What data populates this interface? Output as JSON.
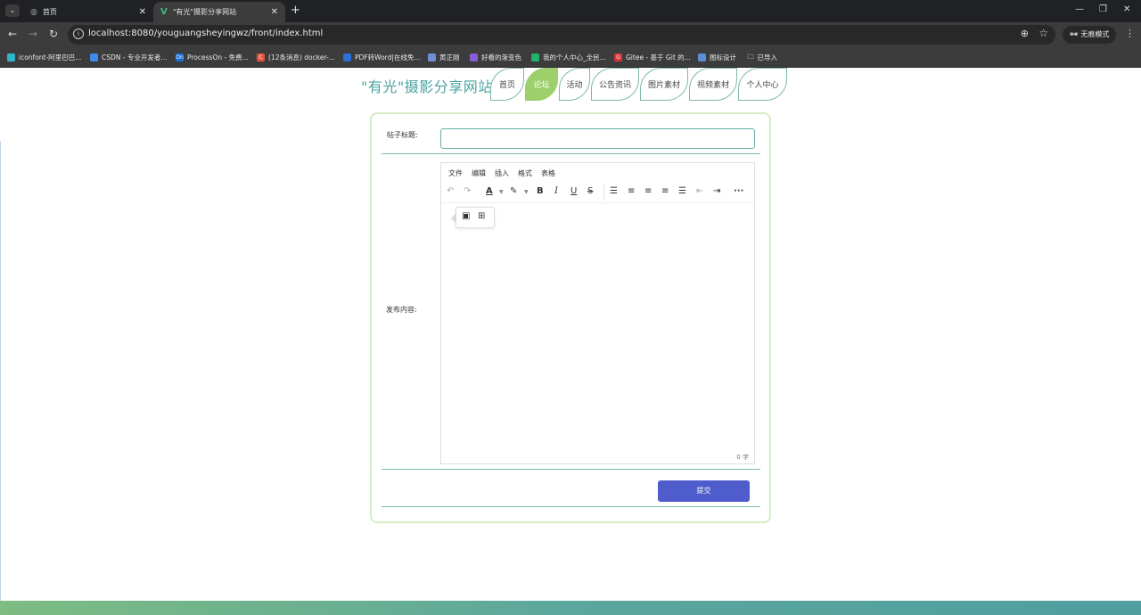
{
  "browser": {
    "tabs": [
      {
        "title": "首页",
        "active": false
      },
      {
        "title": "\"有光\"摄影分享网站",
        "active": true
      }
    ],
    "url": "localhost:8080/youguangsheyingwz/front/index.html",
    "incognito_label": "无痕模式",
    "bookmarks": [
      {
        "label": "iconfont-阿里巴巴...",
        "icon_color": "#2fb6c9"
      },
      {
        "label": "CSDN - 专业开发者...",
        "icon_color": "#3d8bea"
      },
      {
        "label": "ProcessOn - 免费...",
        "icon_color": "#1a6fd6",
        "icon_text": "On"
      },
      {
        "label": "(12条消息) docker-...",
        "icon_color": "#e5533a",
        "icon_text": "C"
      },
      {
        "label": "PDF转Word|在线免...",
        "icon_color": "#2b6fd8"
      },
      {
        "label": "黄正刚",
        "icon_color": "#6d8fd6"
      },
      {
        "label": "好看的渐变色",
        "icon_color": "#8a5cd6"
      },
      {
        "label": "我的个人中心_全民...",
        "icon_color": "#1fb36e"
      },
      {
        "label": "Gitee - 基于 Git 的...",
        "icon_color": "#d6333a",
        "icon_text": "G"
      },
      {
        "label": "图标设计",
        "icon_color": "#5a8ed6"
      },
      {
        "label": "已导入",
        "icon_color": "#888888"
      }
    ]
  },
  "site": {
    "title": "\"有光\"摄影分享网站",
    "nav": [
      {
        "label": "首页",
        "active": false
      },
      {
        "label": "论坛",
        "active": true
      },
      {
        "label": "活动",
        "active": false
      },
      {
        "label": "公告资讯",
        "active": false
      },
      {
        "label": "图片素材",
        "active": false
      },
      {
        "label": "视频素材",
        "active": false
      },
      {
        "label": "个人中心",
        "active": false
      }
    ]
  },
  "form": {
    "title_label": "帖子标题:",
    "title_value": "",
    "content_label": "发布内容:",
    "editor_menu": [
      "文件",
      "编辑",
      "插入",
      "格式",
      "表格"
    ],
    "word_count": "0 字",
    "submit_label": "提交"
  },
  "colors": {
    "accent_green": "#9dcf6a",
    "border_teal": "#7fb8b0",
    "submit_blue": "#4f5ccc",
    "title_teal": "#4aa3a0"
  }
}
